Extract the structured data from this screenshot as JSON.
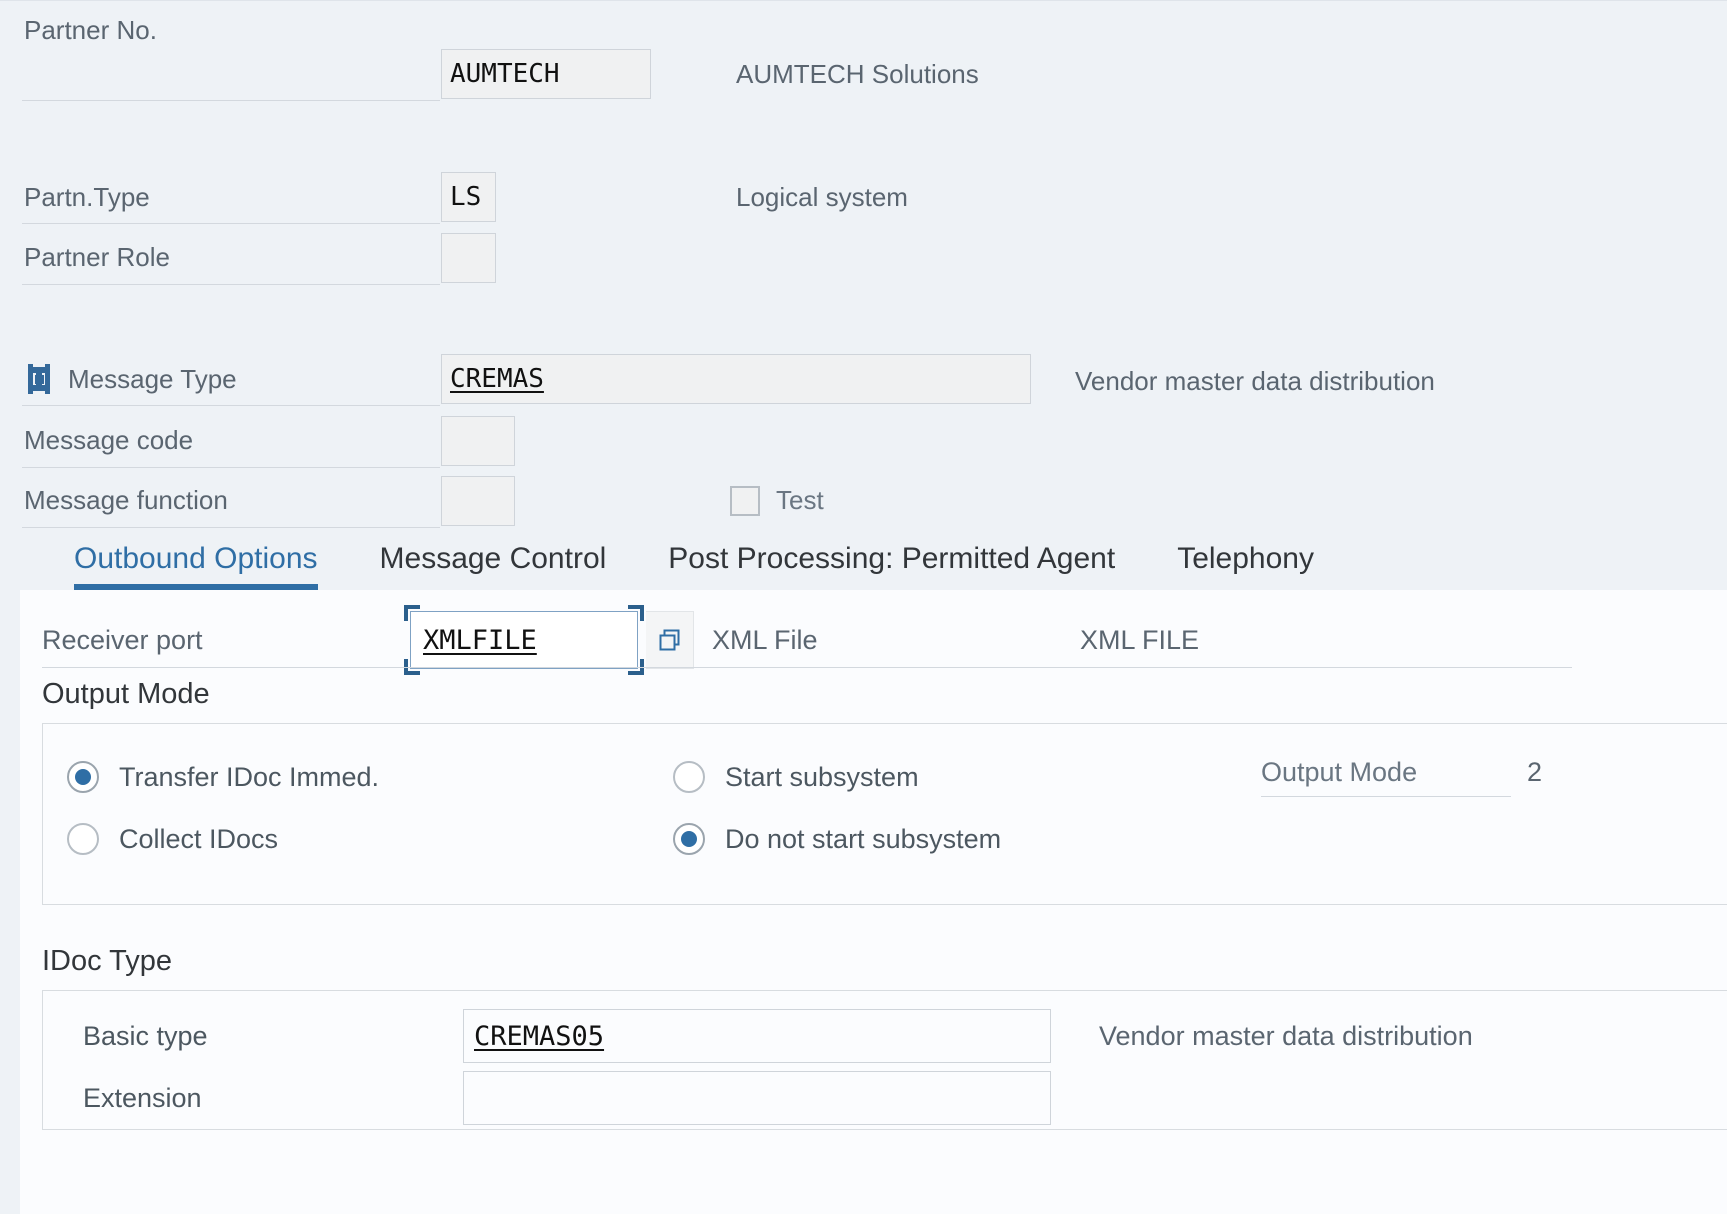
{
  "header": {
    "fields": [
      {
        "label": "Partner No.",
        "value": "AUMTECH",
        "description": "AUMTECH Solutions"
      },
      {
        "label": "Partn.Type",
        "value": "LS",
        "description": "Logical system"
      },
      {
        "label": "Partner Role",
        "value": "",
        "description": ""
      }
    ],
    "message": {
      "icon": "message-type-icon",
      "type_label": "Message Type",
      "type_value": "CREMAS",
      "type_description": "Vendor master data distribution",
      "code_label": "Message code",
      "code_value": "",
      "function_label": "Message function",
      "function_value": "",
      "test_label": "Test",
      "test_checked": false
    }
  },
  "tabs": [
    {
      "label": "Outbound Options",
      "active": true
    },
    {
      "label": "Message Control",
      "active": false
    },
    {
      "label": "Post Processing: Permitted Agent",
      "active": false
    },
    {
      "label": "Telephony",
      "active": false
    }
  ],
  "outbound": {
    "receiver_port": {
      "label": "Receiver port",
      "value": "XMLFILE",
      "value_help_icon": "value-help-copy-icon",
      "description": "XML File",
      "description_far": "XML FILE"
    },
    "output_mode": {
      "title": "Output Mode",
      "options_left": [
        {
          "label": "Transfer IDoc Immed.",
          "selected": true
        },
        {
          "label": "Collect IDocs",
          "selected": false
        }
      ],
      "options_right": [
        {
          "label": "Start subsystem",
          "selected": false
        },
        {
          "label": "Do not start subsystem",
          "selected": true
        }
      ],
      "field_label": "Output Mode",
      "field_value": "2"
    },
    "idoc_type": {
      "title": "IDoc Type",
      "rows": [
        {
          "label": "Basic type",
          "value": "CREMAS05",
          "description": "Vendor master data distribution"
        },
        {
          "label": "Extension",
          "value": "",
          "description": ""
        }
      ]
    }
  },
  "colors": {
    "accent": "#2f6ea5",
    "background": "#eef2f6",
    "panel": "#fbfcfe",
    "label": "#5a6570"
  }
}
